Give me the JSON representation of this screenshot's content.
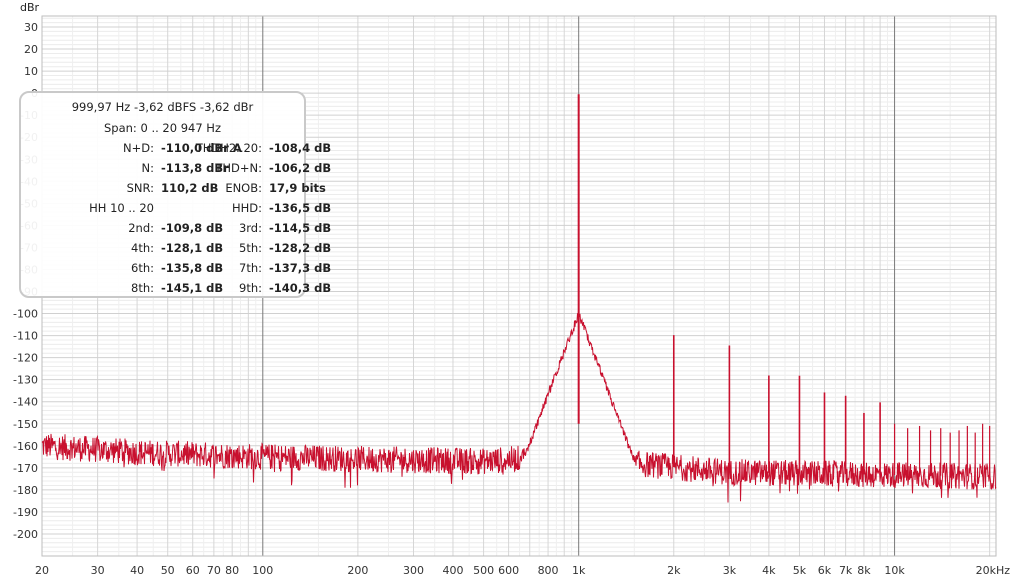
{
  "chart_data": {
    "type": "line",
    "ylabel": "dBr",
    "x_scale": "log",
    "xlim": [
      20,
      20947
    ],
    "ylim": [
      -210,
      35
    ],
    "x_ticks": [
      {
        "v": 20,
        "label": "20"
      },
      {
        "v": 30,
        "label": "30"
      },
      {
        "v": 40,
        "label": "40"
      },
      {
        "v": 50,
        "label": "50"
      },
      {
        "v": 60,
        "label": "60"
      },
      {
        "v": 70,
        "label": "70"
      },
      {
        "v": 80,
        "label": "80"
      },
      {
        "v": 100,
        "label": "100"
      },
      {
        "v": 200,
        "label": "200"
      },
      {
        "v": 300,
        "label": "300"
      },
      {
        "v": 400,
        "label": "400"
      },
      {
        "v": 500,
        "label": "500"
      },
      {
        "v": 600,
        "label": "600"
      },
      {
        "v": 800,
        "label": "800"
      },
      {
        "v": 1000,
        "label": "1k"
      },
      {
        "v": 2000,
        "label": "2k"
      },
      {
        "v": 3000,
        "label": "3k"
      },
      {
        "v": 4000,
        "label": "4k"
      },
      {
        "v": 5000,
        "label": "5k"
      },
      {
        "v": 6000,
        "label": "6k"
      },
      {
        "v": 7000,
        "label": "7k"
      },
      {
        "v": 8000,
        "label": "8k"
      },
      {
        "v": 10000,
        "label": "10k"
      },
      {
        "v": 20000,
        "label": "20kHz"
      }
    ],
    "y_ticks": [
      30,
      20,
      10,
      0,
      -10,
      -20,
      -30,
      -40,
      -50,
      -60,
      -70,
      -80,
      -90,
      -100,
      -110,
      -120,
      -130,
      -140,
      -150,
      -160,
      -170,
      -180,
      -190,
      -200
    ],
    "series": [
      {
        "color": "#c8102e",
        "fundamental": {
          "x": 999.97,
          "y": -0.5
        },
        "harmonics": [
          {
            "x": 2000,
            "y": -109.8
          },
          {
            "x": 3000,
            "y": -114.5
          },
          {
            "x": 4000,
            "y": -128.1
          },
          {
            "x": 5000,
            "y": -128.2
          },
          {
            "x": 6000,
            "y": -135.8
          },
          {
            "x": 7000,
            "y": -137.3
          },
          {
            "x": 8000,
            "y": -145.1
          },
          {
            "x": 9000,
            "y": -140.3
          }
        ],
        "noise_floor": [
          {
            "x": 20,
            "y": -160
          },
          {
            "x": 40,
            "y": -163
          },
          {
            "x": 100,
            "y": -165
          },
          {
            "x": 200,
            "y": -166
          },
          {
            "x": 500,
            "y": -167
          },
          {
            "x": 800,
            "y": -165
          },
          {
            "x": 1500,
            "y": -168
          },
          {
            "x": 3000,
            "y": -172
          },
          {
            "x": 20947,
            "y": -174
          }
        ]
      }
    ]
  },
  "info_panel": {
    "header": "999,97 Hz  -3,62 dBFS  -3,62 dBr",
    "span": "Span: 0 .. 20 947 Hz",
    "rows": [
      {
        "l1": "N+D:",
        "v1": "-110,0 dBr A",
        "l2": "THDH2..20:",
        "v2": "-108,4 dB"
      },
      {
        "l1": "N:",
        "v1": "-113,8 dBr",
        "l2": "THD+N:",
        "v2": "-106,2 dB"
      },
      {
        "l1": "SNR:",
        "v1": "110,2 dB",
        "l2": "ENOB:",
        "v2": "17,9 bits"
      },
      {
        "l1": "HH 10 .. 20",
        "v1": "",
        "l2": "HHD:",
        "v2": "-136,5 dB"
      },
      {
        "l1": "2nd:",
        "v1": "-109,8 dB",
        "l2": "3rd:",
        "v2": "-114,5 dB"
      },
      {
        "l1": "4th:",
        "v1": "-128,1 dB",
        "l2": "5th:",
        "v2": "-128,2 dB"
      },
      {
        "l1": "6th:",
        "v1": "-135,8 dB",
        "l2": "7th:",
        "v2": "-137,3 dB"
      },
      {
        "l1": "8th:",
        "v1": "-145,1 dB",
        "l2": "9th:",
        "v2": "-140,3 dB"
      }
    ]
  }
}
